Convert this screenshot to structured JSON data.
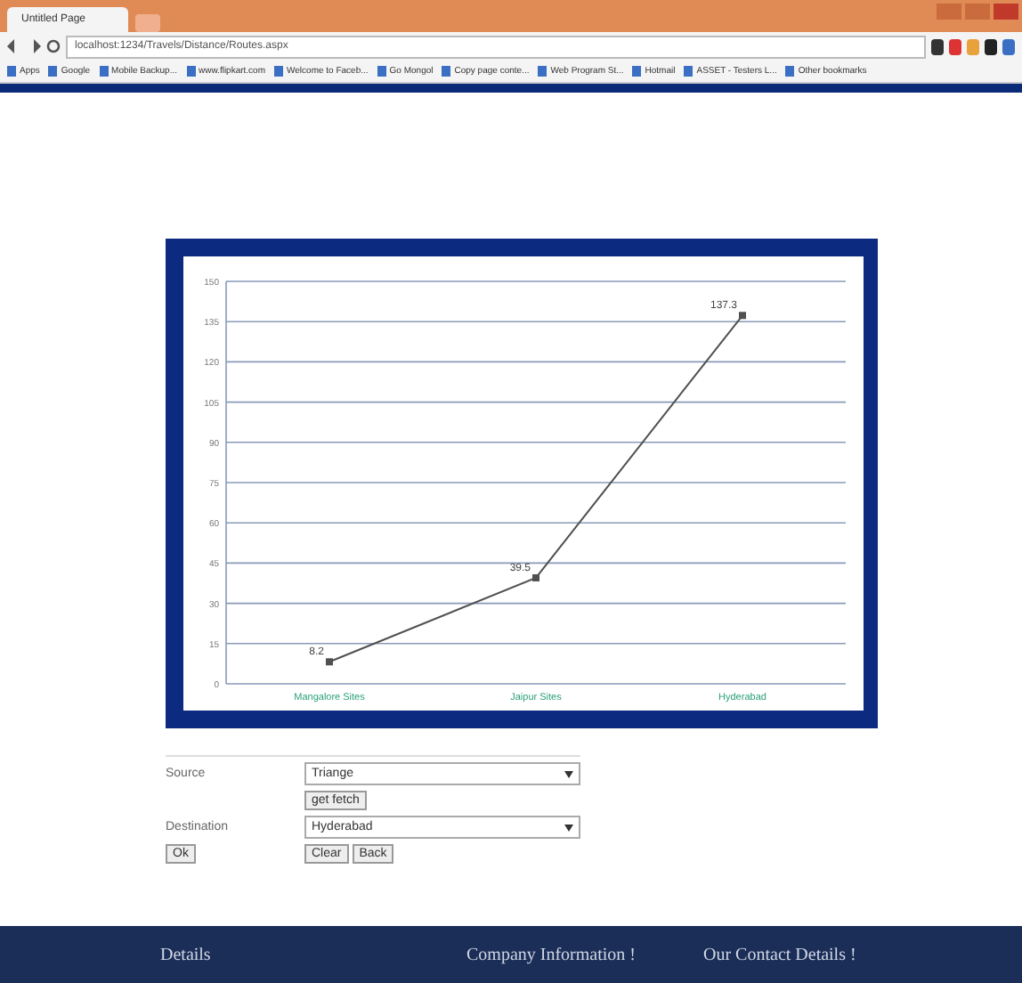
{
  "browser": {
    "tab_title": "Untitled Page",
    "url": "localhost:1234/Travels/Distance/Routes.aspx",
    "bookmarks": [
      "Apps",
      "Google",
      "Mobile Backup...",
      "www.flipkart.com",
      "Welcome to Faceb...",
      "Go Mongol",
      "Copy page conte...",
      "Web Program St...",
      "Hotmail",
      "ASSET - Testers L...",
      "Other bookmarks"
    ]
  },
  "chart": {
    "chart_data": {
      "type": "line",
      "categories": [
        "Mangalore Sites",
        "Jaipur Sites",
        "Hyderabad"
      ],
      "series": [
        {
          "color": "#505050",
          "marker": "square",
          "values": [
            8.2,
            39.5,
            137.3
          ]
        }
      ],
      "grid": true,
      "ylim": [
        0,
        150
      ],
      "yticks": [
        0,
        15,
        30,
        45,
        60,
        75,
        90,
        105,
        120,
        135,
        150
      ],
      "data_labels": true
    }
  },
  "form": {
    "rows": [
      {
        "label": "Source",
        "kind": "select",
        "value": "Triange"
      },
      {
        "kind": "buttons",
        "buttons": [
          "get fetch"
        ]
      },
      {
        "label": "Destination",
        "kind": "select",
        "value": "Hyderabad"
      },
      {
        "kind": "buttons",
        "label_button": "Ok",
        "buttons": [
          "Clear",
          "Back"
        ]
      }
    ]
  },
  "footer": {
    "links": [
      "Details",
      "Company Information !",
      "Our Contact Details !"
    ]
  }
}
